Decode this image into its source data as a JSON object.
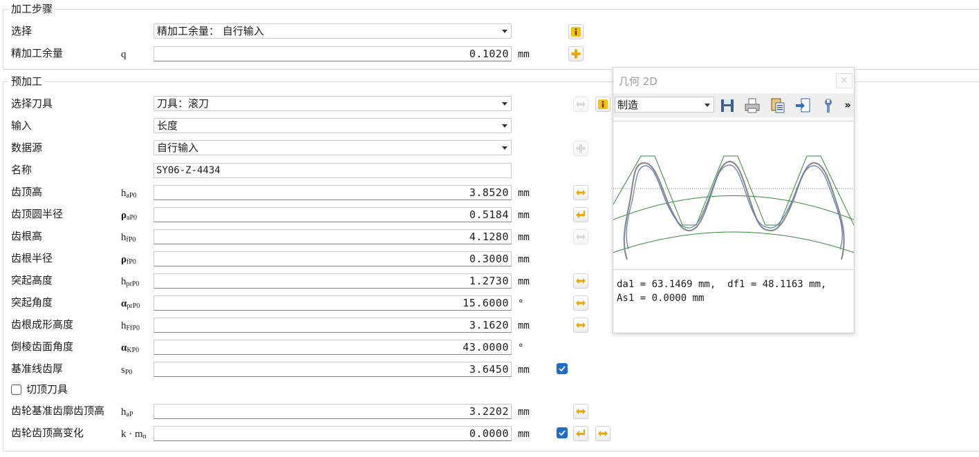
{
  "groups": {
    "finishing": "加工步骤",
    "preprocess": "预加工"
  },
  "finishing": {
    "select_label": "选择",
    "select_value": "精加工余量： 自行输入",
    "allowance_label": "精加工余量",
    "allowance_symbol": "q",
    "allowance_value": "0.1020",
    "allowance_unit": "mm"
  },
  "pre": {
    "tool_label": "选择刀具",
    "tool_value": "刀具：滚刀",
    "input_label": "输入",
    "input_value": "长度",
    "source_label": "数据源",
    "source_value": "自行输入",
    "name_label": "名称",
    "name_value": "SY06-Z-4434",
    "rows": [
      {
        "label": "齿顶高",
        "sym": "h",
        "sub": "aP0",
        "greek": false,
        "value": "3.8520",
        "unit": "mm"
      },
      {
        "label": "齿顶圆半径",
        "sym": "ρ",
        "sub": "aP0",
        "greek": true,
        "value": "0.5184",
        "unit": "mm"
      },
      {
        "label": "齿根高",
        "sym": "h",
        "sub": "fP0",
        "greek": false,
        "value": "4.1280",
        "unit": "mm"
      },
      {
        "label": "齿根半径",
        "sym": "ρ",
        "sub": "fP0",
        "greek": true,
        "value": "0.3000",
        "unit": "mm"
      },
      {
        "label": "突起高度",
        "sym": "h",
        "sub": "prP0",
        "greek": false,
        "value": "1.2730",
        "unit": "mm"
      },
      {
        "label": "突起角度",
        "sym": "α",
        "sub": "prP0",
        "greek": true,
        "value": "15.6000",
        "unit": "°"
      },
      {
        "label": "齿根成形高度",
        "sym": "h",
        "sub": "FfP0",
        "greek": false,
        "value": "3.1620",
        "unit": "mm"
      },
      {
        "label": "倒棱齿面角度",
        "sym": "α",
        "sub": "KP0",
        "greek": true,
        "value": "43.0000",
        "unit": "°"
      },
      {
        "label": "基准线齿厚",
        "sym": "s",
        "sub": "P0",
        "greek": false,
        "value": "3.6450",
        "unit": "mm"
      }
    ],
    "tip_cut_label": "切顶刀具",
    "rack_label": "齿轮基准齿廓齿顶高",
    "rack_sym": "h",
    "rack_sub": "aP",
    "rack_value": "3.2202",
    "rack_unit": "mm",
    "change_label": "齿轮齿顶高变化",
    "change_sym": "k · m",
    "change_sub": "n",
    "change_value": "0.0000",
    "change_unit": "mm"
  },
  "panel": {
    "title": "几何 2D",
    "close": "×",
    "mode": "制造",
    "more": "»",
    "info_line1": "da1 = 63.1469 mm,  df1 = 48.1163 mm,",
    "info_line2": "As1 = 0.0000 mm"
  },
  "icons": {
    "info": "info-icon",
    "add": "plus-icon",
    "transfer": "double-arrow-icon",
    "return": "return-arrow-icon",
    "save": "save-icon",
    "print": "print-icon",
    "copy": "copy-icon",
    "export": "export-icon",
    "settings": "wrench-icon"
  },
  "colors": {
    "accent": "#1f6dc8",
    "icon_yellow": "#e8a800",
    "profile_green": "#2e8b2e",
    "profile_gray": "#8a8a8a",
    "profile_blue": "#5577bb"
  }
}
